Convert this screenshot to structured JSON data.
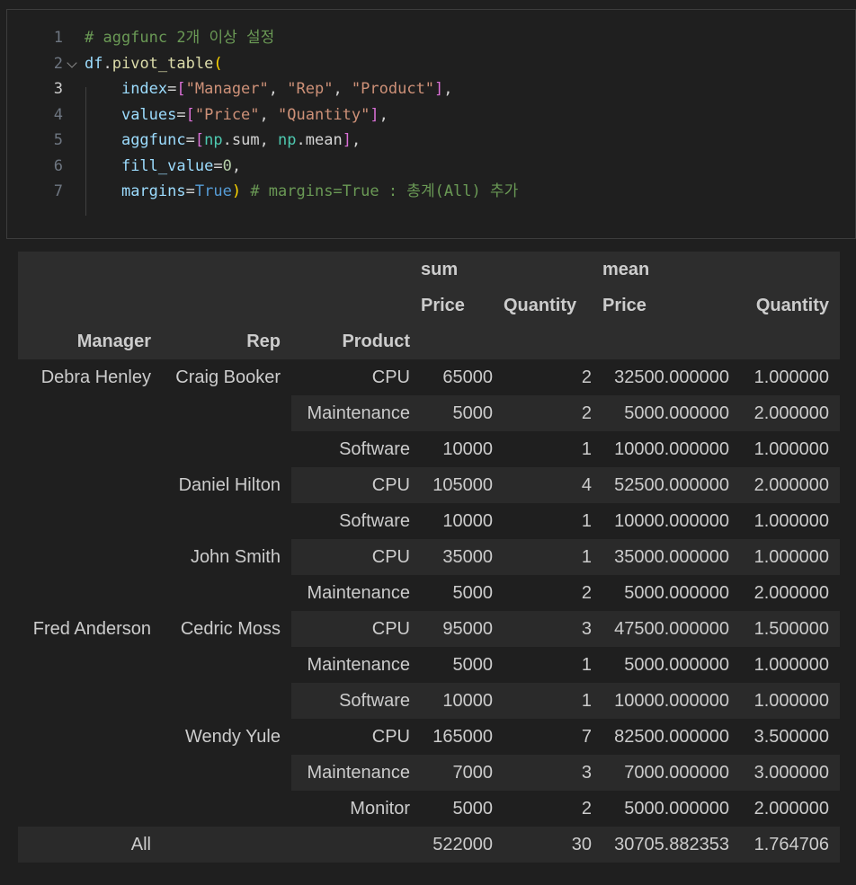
{
  "code": {
    "lines": [
      {
        "n": "1",
        "tokens": [
          {
            "c": "t-com",
            "t": "# aggfunc 2개 이상 설정"
          }
        ]
      },
      {
        "n": "2",
        "tokens": [
          {
            "c": "t-var",
            "t": "df"
          },
          {
            "c": "t-plain",
            "t": "."
          },
          {
            "c": "t-fn",
            "t": "pivot_table"
          },
          {
            "c": "t-p1",
            "t": "("
          }
        ]
      },
      {
        "n": "3",
        "tokens": [
          {
            "c": "t-plain",
            "t": "    "
          },
          {
            "c": "t-var",
            "t": "index"
          },
          {
            "c": "t-op",
            "t": "="
          },
          {
            "c": "t-p2",
            "t": "["
          },
          {
            "c": "t-str",
            "t": "\"Manager\""
          },
          {
            "c": "t-plain",
            "t": ", "
          },
          {
            "c": "t-str",
            "t": "\"Rep\""
          },
          {
            "c": "t-plain",
            "t": ", "
          },
          {
            "c": "t-str",
            "t": "\"Product\""
          },
          {
            "c": "t-p2",
            "t": "]"
          },
          {
            "c": "t-plain",
            "t": ","
          }
        ]
      },
      {
        "n": "4",
        "tokens": [
          {
            "c": "t-plain",
            "t": "    "
          },
          {
            "c": "t-var",
            "t": "values"
          },
          {
            "c": "t-op",
            "t": "="
          },
          {
            "c": "t-p2",
            "t": "["
          },
          {
            "c": "t-str",
            "t": "\"Price\""
          },
          {
            "c": "t-plain",
            "t": ", "
          },
          {
            "c": "t-str",
            "t": "\"Quantity\""
          },
          {
            "c": "t-p2",
            "t": "]"
          },
          {
            "c": "t-plain",
            "t": ","
          }
        ]
      },
      {
        "n": "5",
        "tokens": [
          {
            "c": "t-plain",
            "t": "    "
          },
          {
            "c": "t-var",
            "t": "aggfunc"
          },
          {
            "c": "t-op",
            "t": "="
          },
          {
            "c": "t-p2",
            "t": "["
          },
          {
            "c": "t-cls",
            "t": "np"
          },
          {
            "c": "t-plain",
            "t": "."
          },
          {
            "c": "t-plain",
            "t": "sum"
          },
          {
            "c": "t-plain",
            "t": ", "
          },
          {
            "c": "t-cls",
            "t": "np"
          },
          {
            "c": "t-plain",
            "t": "."
          },
          {
            "c": "t-plain",
            "t": "mean"
          },
          {
            "c": "t-p2",
            "t": "]"
          },
          {
            "c": "t-plain",
            "t": ","
          }
        ]
      },
      {
        "n": "6",
        "tokens": [
          {
            "c": "t-plain",
            "t": "    "
          },
          {
            "c": "t-var",
            "t": "fill_value"
          },
          {
            "c": "t-op",
            "t": "="
          },
          {
            "c": "t-num",
            "t": "0"
          },
          {
            "c": "t-plain",
            "t": ","
          }
        ]
      },
      {
        "n": "7",
        "tokens": [
          {
            "c": "t-plain",
            "t": "    "
          },
          {
            "c": "t-var",
            "t": "margins"
          },
          {
            "c": "t-op",
            "t": "="
          },
          {
            "c": "t-kw",
            "t": "True"
          },
          {
            "c": "t-p1",
            "t": ")"
          },
          {
            "c": "t-plain",
            "t": " "
          },
          {
            "c": "t-com",
            "t": "# margins=True : 총계(All) 추가"
          }
        ]
      }
    ]
  },
  "table": {
    "header_top": [
      "sum",
      "mean"
    ],
    "header_mid": [
      "Price",
      "Quantity",
      "Price",
      "Quantity"
    ],
    "index_names": [
      "Manager",
      "Rep",
      "Product"
    ],
    "rows": [
      {
        "manager": "Debra Henley",
        "rep": "Craig Booker",
        "product": "CPU",
        "sum_price": "65000",
        "sum_qty": "2",
        "mean_price": "32500.000000",
        "mean_qty": "1.000000"
      },
      {
        "manager": "",
        "rep": "",
        "product": "Maintenance",
        "sum_price": "5000",
        "sum_qty": "2",
        "mean_price": "5000.000000",
        "mean_qty": "2.000000"
      },
      {
        "manager": "",
        "rep": "",
        "product": "Software",
        "sum_price": "10000",
        "sum_qty": "1",
        "mean_price": "10000.000000",
        "mean_qty": "1.000000"
      },
      {
        "manager": "",
        "rep": "Daniel Hilton",
        "product": "CPU",
        "sum_price": "105000",
        "sum_qty": "4",
        "mean_price": "52500.000000",
        "mean_qty": "2.000000"
      },
      {
        "manager": "",
        "rep": "",
        "product": "Software",
        "sum_price": "10000",
        "sum_qty": "1",
        "mean_price": "10000.000000",
        "mean_qty": "1.000000"
      },
      {
        "manager": "",
        "rep": "John Smith",
        "product": "CPU",
        "sum_price": "35000",
        "sum_qty": "1",
        "mean_price": "35000.000000",
        "mean_qty": "1.000000"
      },
      {
        "manager": "",
        "rep": "",
        "product": "Maintenance",
        "sum_price": "5000",
        "sum_qty": "2",
        "mean_price": "5000.000000",
        "mean_qty": "2.000000"
      },
      {
        "manager": "Fred Anderson",
        "rep": "Cedric Moss",
        "product": "CPU",
        "sum_price": "95000",
        "sum_qty": "3",
        "mean_price": "47500.000000",
        "mean_qty": "1.500000"
      },
      {
        "manager": "",
        "rep": "",
        "product": "Maintenance",
        "sum_price": "5000",
        "sum_qty": "1",
        "mean_price": "5000.000000",
        "mean_qty": "1.000000"
      },
      {
        "manager": "",
        "rep": "",
        "product": "Software",
        "sum_price": "10000",
        "sum_qty": "1",
        "mean_price": "10000.000000",
        "mean_qty": "1.000000"
      },
      {
        "manager": "",
        "rep": "Wendy Yule",
        "product": "CPU",
        "sum_price": "165000",
        "sum_qty": "7",
        "mean_price": "82500.000000",
        "mean_qty": "3.500000"
      },
      {
        "manager": "",
        "rep": "",
        "product": "Maintenance",
        "sum_price": "7000",
        "sum_qty": "3",
        "mean_price": "7000.000000",
        "mean_qty": "3.000000"
      },
      {
        "manager": "",
        "rep": "",
        "product": "Monitor",
        "sum_price": "5000",
        "sum_qty": "2",
        "mean_price": "5000.000000",
        "mean_qty": "2.000000"
      },
      {
        "manager": "All",
        "rep": "",
        "product": "",
        "sum_price": "522000",
        "sum_qty": "30",
        "mean_price": "30705.882353",
        "mean_qty": "1.764706"
      }
    ]
  }
}
